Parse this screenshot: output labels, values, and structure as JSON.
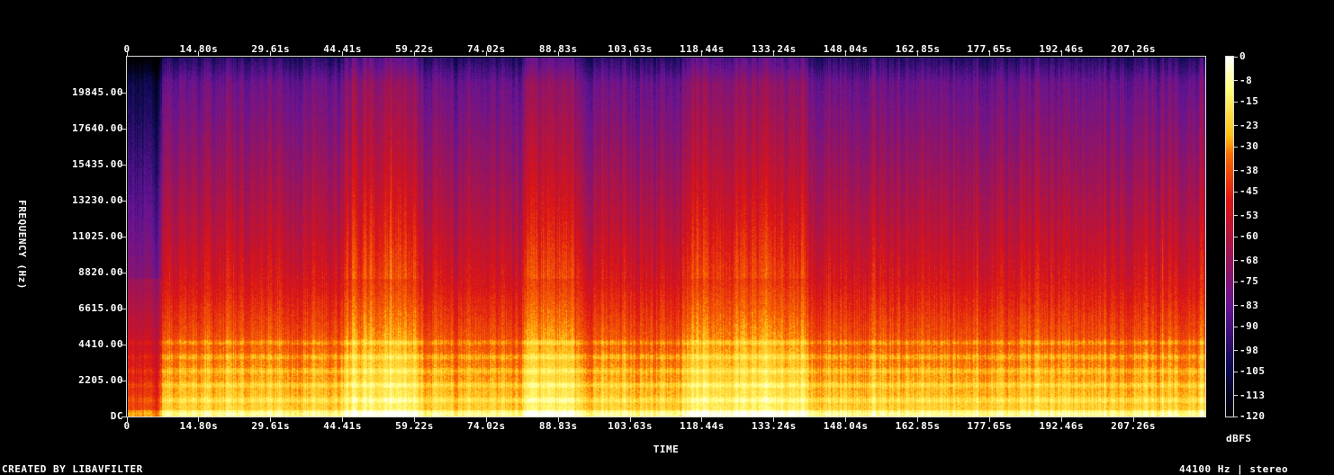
{
  "chart_data": {
    "type": "heatmap",
    "subtype": "spectrogram",
    "title": "",
    "xlabel": "TIME",
    "ylabel": "FREQUENCY (Hz)",
    "x_ticks": [
      "0",
      "14.80s",
      "29.61s",
      "44.41s",
      "59.22s",
      "74.02s",
      "88.83s",
      "103.63s",
      "118.44s",
      "133.24s",
      "148.04s",
      "162.85s",
      "177.65s",
      "192.46s",
      "207.26s"
    ],
    "x_tick_seconds": [
      0,
      14.8,
      29.61,
      44.41,
      59.22,
      74.02,
      88.83,
      103.63,
      118.44,
      133.24,
      148.04,
      162.85,
      177.65,
      192.46,
      207.26
    ],
    "x_range_seconds": [
      0,
      222.07
    ],
    "y_ticks": [
      "DC",
      "2205.00",
      "4410.00",
      "6615.00",
      "8820.00",
      "11025.00",
      "13230.00",
      "15435.00",
      "17640.00",
      "19845.00"
    ],
    "y_tick_hz": [
      0,
      2205,
      4410,
      6615,
      8820,
      11025,
      13230,
      15435,
      17640,
      19845
    ],
    "y_range_hz": [
      0,
      22050
    ],
    "colorbar": {
      "label": "dBFS",
      "ticks": [
        "0",
        "-8",
        "-15",
        "-23",
        "-30",
        "-38",
        "-45",
        "-53",
        "-60",
        "-68",
        "-75",
        "-83",
        "-90",
        "-98",
        "-105",
        "-113",
        "-120"
      ],
      "tick_values": [
        0,
        -8,
        -15,
        -23,
        -30,
        -38,
        -45,
        -53,
        -60,
        -68,
        -75,
        -83,
        -90,
        -98,
        -105,
        -113,
        -120
      ],
      "range": [
        -120,
        0
      ],
      "colormap": "intensity (black → navy → purple → red → orange → yellow → white)"
    },
    "louder_sections_seconds": [
      [
        44.4,
        60
      ],
      [
        82,
        92
      ],
      [
        115,
        140
      ]
    ],
    "quiet_intro_seconds": [
      0,
      7
    ]
  },
  "footer": {
    "left": "CREATED BY LIBAVFILTER",
    "right": "44100 Hz | stereo"
  },
  "colors": {
    "background": "#000000",
    "text": "#ffffff",
    "frame": "#d8d8d8"
  }
}
